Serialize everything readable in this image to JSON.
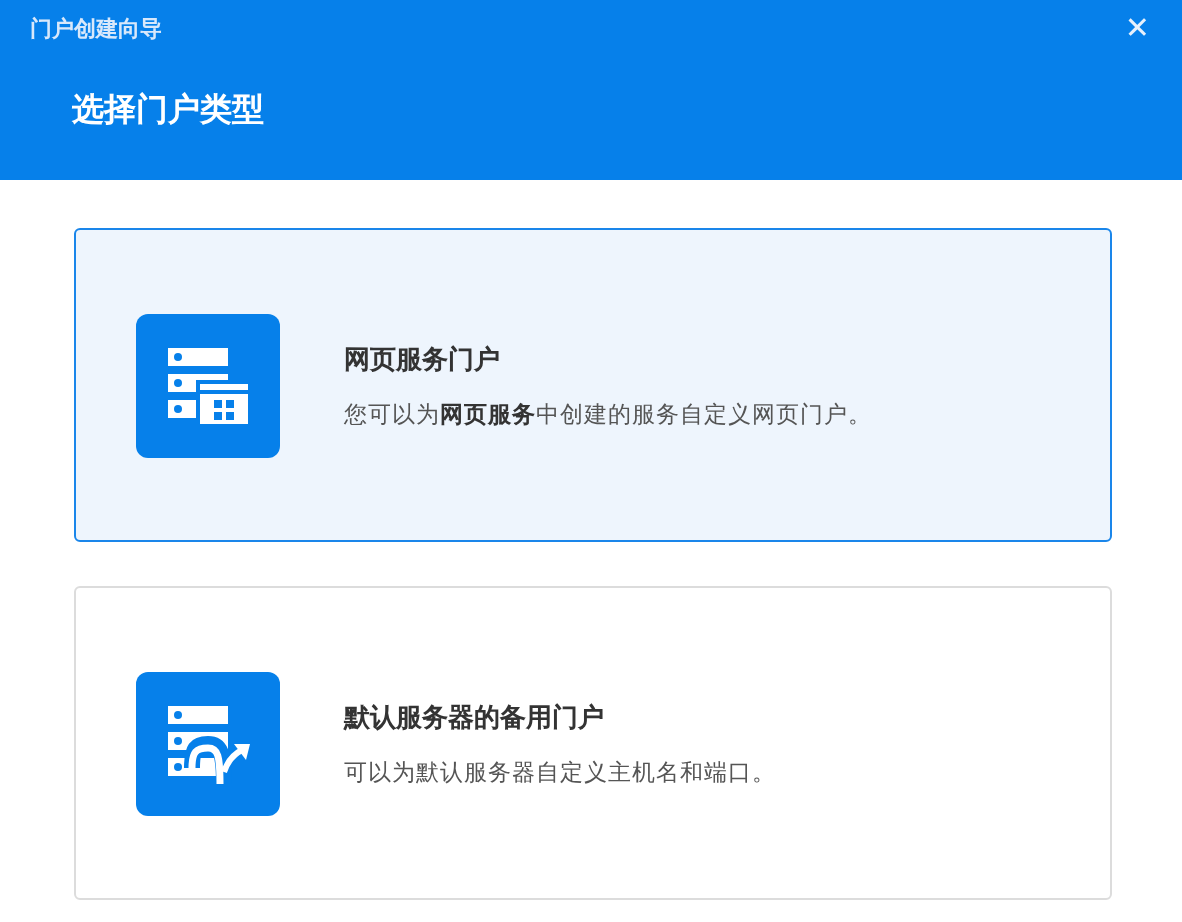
{
  "window": {
    "title": "门户创建向导",
    "close": "✕"
  },
  "heading": "选择门户类型",
  "options": [
    {
      "kind": "web",
      "title": "网页服务门户",
      "description": "您可以为**网页服务**中创建的服务自定义网页门户。",
      "selected": true
    },
    {
      "kind": "fallback",
      "title": "默认服务器的备用门户",
      "description": "可以为默认服务器自定义主机名和端口。",
      "selected": false
    }
  ]
}
